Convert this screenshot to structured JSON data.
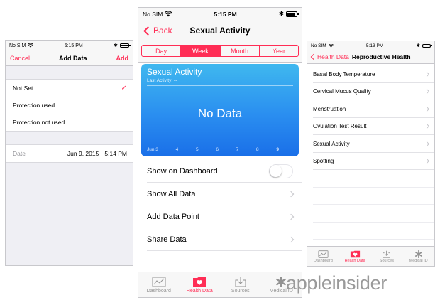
{
  "watermark": "appleinsider",
  "left": {
    "status": {
      "carrier": "No SIM",
      "time": "5:15 PM"
    },
    "nav": {
      "cancel": "Cancel",
      "title": "Add Data",
      "add": "Add"
    },
    "options": [
      {
        "label": "Not Set",
        "checked": true
      },
      {
        "label": "Protection used",
        "checked": false
      },
      {
        "label": "Protection not used",
        "checked": false
      }
    ],
    "date": {
      "label": "Date",
      "date": "Jun 9, 2015",
      "time": "5:14 PM"
    }
  },
  "center": {
    "status": {
      "carrier": "No SIM",
      "time": "5:15 PM"
    },
    "nav": {
      "back": "Back",
      "title": "Sexual Activity"
    },
    "segments": [
      {
        "label": "Day",
        "active": false
      },
      {
        "label": "Week",
        "active": true
      },
      {
        "label": "Month",
        "active": false
      },
      {
        "label": "Year",
        "active": false
      }
    ],
    "card": {
      "title": "Sexual Activity",
      "subtitle": "Last Activity: --",
      "no_data": "No Data",
      "x_labels": [
        "Jun 3",
        "4",
        "5",
        "6",
        "7",
        "8",
        "9"
      ]
    },
    "rows": {
      "show_on_dashboard": "Show on Dashboard",
      "show_all_data": "Show All Data",
      "add_data_point": "Add Data Point",
      "share_data": "Share Data"
    },
    "toggle_on": false,
    "tabs": {
      "dashboard": "Dashboard",
      "health_data": "Health Data",
      "sources": "Sources",
      "medical_id": "Medical ID"
    },
    "active_tab": "health_data"
  },
  "right": {
    "status": {
      "carrier": "No SIM",
      "time": "5:13 PM"
    },
    "nav": {
      "back": "Health Data",
      "title": "Reproductive Health"
    },
    "items": [
      "Basal Body Temperature",
      "Cervical Mucus Quality",
      "Menstruation",
      "Ovulation Test Result",
      "Sexual Activity",
      "Spotting"
    ],
    "tabs": {
      "dashboard": "Dashboard",
      "health_data": "Health Data",
      "sources": "Sources",
      "medical_id": "Medical ID"
    },
    "active_tab": "health_data"
  },
  "colors": {
    "accent": "#ff2d55",
    "card_top": "#3fb8ef",
    "card_bottom": "#1a6fe8"
  },
  "icons": [
    "wifi-icon",
    "bluetooth-icon",
    "battery-icon",
    "checkmark-icon",
    "back-chevron-icon",
    "disclosure-chevron-icon",
    "dashboard-icon",
    "health-data-icon",
    "sources-icon",
    "medical-id-icon"
  ]
}
